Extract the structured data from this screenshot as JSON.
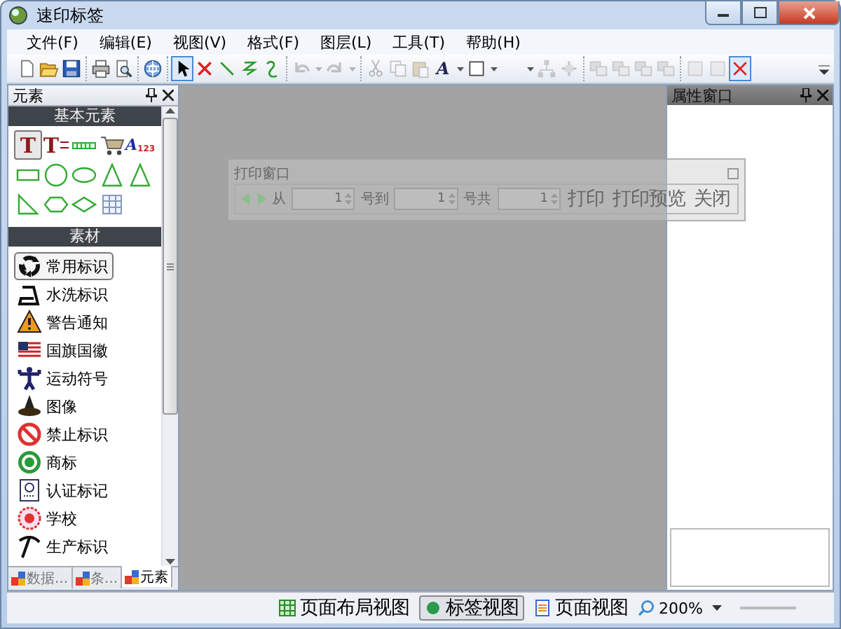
{
  "window": {
    "title": "速印标签"
  },
  "menu": [
    "文件(F)",
    "编辑(E)",
    "视图(V)",
    "格式(F)",
    "图层(L)",
    "工具(T)",
    "帮助(H)"
  ],
  "toolbar": [
    [
      {
        "kind": "new",
        "disabled": false,
        "selected": false
      },
      {
        "kind": "open",
        "disabled": false,
        "selected": false
      },
      {
        "kind": "save",
        "disabled": false,
        "selected": false
      }
    ],
    [
      {
        "kind": "print",
        "disabled": false,
        "selected": false
      },
      {
        "kind": "preview",
        "disabled": false,
        "selected": false
      }
    ],
    [
      {
        "kind": "globe",
        "disabled": false,
        "selected": false
      }
    ],
    [
      {
        "kind": "pointer",
        "disabled": false,
        "selected": true
      },
      {
        "kind": "delete",
        "disabled": false,
        "selected": false
      },
      {
        "kind": "line",
        "disabled": false,
        "selected": false
      },
      {
        "kind": "zigzag",
        "disabled": false,
        "selected": false
      },
      {
        "kind": "curve",
        "disabled": false,
        "selected": false
      }
    ],
    [
      {
        "kind": "undo",
        "disabled": true,
        "selected": false
      },
      {
        "kind": "caret",
        "disabled": true,
        "selected": false
      },
      {
        "kind": "redo",
        "disabled": true,
        "selected": false
      },
      {
        "kind": "caret",
        "disabled": true,
        "selected": false
      }
    ],
    [
      {
        "kind": "cut",
        "disabled": true,
        "selected": false
      },
      {
        "kind": "copy",
        "disabled": true,
        "selected": false
      },
      {
        "kind": "paste",
        "disabled": true,
        "selected": false
      },
      {
        "kind": "font",
        "text": "A",
        "disabled": false,
        "selected": false
      },
      {
        "kind": "caret",
        "disabled": false,
        "selected": false
      },
      {
        "kind": "rect",
        "disabled": false,
        "selected": false
      },
      {
        "kind": "caret",
        "disabled": false,
        "selected": false
      },
      {
        "kind": "spacer"
      },
      {
        "kind": "caret",
        "disabled": false,
        "selected": false
      },
      {
        "kind": "tree",
        "disabled": true,
        "selected": false
      },
      {
        "kind": "plus",
        "disabled": true,
        "selected": false
      }
    ],
    [
      {
        "kind": "align",
        "disabled": true,
        "selected": false
      },
      {
        "kind": "align",
        "disabled": true,
        "selected": false
      },
      {
        "kind": "align",
        "disabled": true,
        "selected": false
      },
      {
        "kind": "align",
        "disabled": true,
        "selected": false
      }
    ],
    [
      {
        "kind": "square",
        "disabled": true,
        "selected": false
      },
      {
        "kind": "square",
        "disabled": true,
        "selected": false
      },
      {
        "kind": "xbox",
        "disabled": false,
        "selected": true
      }
    ]
  ],
  "left_panel": {
    "title": "元素",
    "basic": {
      "title": "基本元素",
      "items": [
        {
          "kind": "text",
          "glyph": "T",
          "selected": true
        },
        {
          "kind": "multiline",
          "glyph": "T",
          "selected": false
        },
        {
          "kind": "barcode",
          "selected": false
        },
        {
          "kind": "cart",
          "selected": false
        },
        {
          "kind": "wordart",
          "glyph": "A",
          "subtext": "123",
          "selected": false
        },
        {
          "kind": "rect",
          "selected": false
        },
        {
          "kind": "circle",
          "selected": false
        },
        {
          "kind": "ellipse",
          "selected": false
        },
        {
          "kind": "triangle",
          "selected": false
        },
        {
          "kind": "triangle",
          "selected": false
        },
        {
          "kind": "right-triangle",
          "selected": false
        },
        {
          "kind": "hexagon",
          "selected": false
        },
        {
          "kind": "diamond",
          "selected": false
        },
        {
          "kind": "table",
          "selected": false
        }
      ]
    },
    "materials": {
      "title": "素材",
      "items": [
        {
          "label": "常用标识",
          "kind": "recycle",
          "selected": true
        },
        {
          "label": "水洗标识",
          "kind": "iron",
          "selected": false
        },
        {
          "label": "警告通知",
          "kind": "warning",
          "selected": false
        },
        {
          "label": "国旗国徽",
          "kind": "flag",
          "selected": false
        },
        {
          "label": "运动符号",
          "kind": "figure",
          "selected": false
        },
        {
          "label": "图像",
          "kind": "hat",
          "selected": false
        },
        {
          "label": "禁止标识",
          "kind": "prohibition",
          "selected": false
        },
        {
          "label": "商标",
          "kind": "logo",
          "selected": false
        },
        {
          "label": "认证标记",
          "kind": "certificate",
          "selected": false
        },
        {
          "label": "学校",
          "kind": "seal",
          "selected": false
        },
        {
          "label": "生产标识",
          "kind": "pickaxe",
          "selected": false
        }
      ]
    },
    "tabs": [
      {
        "label": "数据...",
        "selected": false
      },
      {
        "label": "条...",
        "selected": false
      },
      {
        "label": "元素",
        "selected": true
      }
    ]
  },
  "print_window": {
    "title": "打印窗口",
    "row": [
      {
        "kind": "prev"
      },
      {
        "kind": "next"
      },
      {
        "kind": "label",
        "text": "从"
      },
      {
        "kind": "spin",
        "value": "1"
      },
      {
        "kind": "label",
        "text": "号到"
      },
      {
        "kind": "spin",
        "value": "1"
      },
      {
        "kind": "label",
        "text": "号共"
      },
      {
        "kind": "spin",
        "value": "1"
      },
      {
        "kind": "button",
        "text": "打印"
      },
      {
        "kind": "button",
        "text": "打印预览"
      },
      {
        "kind": "button",
        "text": "关闭"
      }
    ]
  },
  "right_panel": {
    "title": "属性窗口"
  },
  "status_bar": {
    "views": [
      {
        "label": "页面布局视图",
        "kind": "layout",
        "selected": false
      },
      {
        "label": "标签视图",
        "kind": "label",
        "selected": true
      },
      {
        "label": "页面视图",
        "kind": "page",
        "selected": false
      }
    ],
    "zoom": "200%"
  }
}
